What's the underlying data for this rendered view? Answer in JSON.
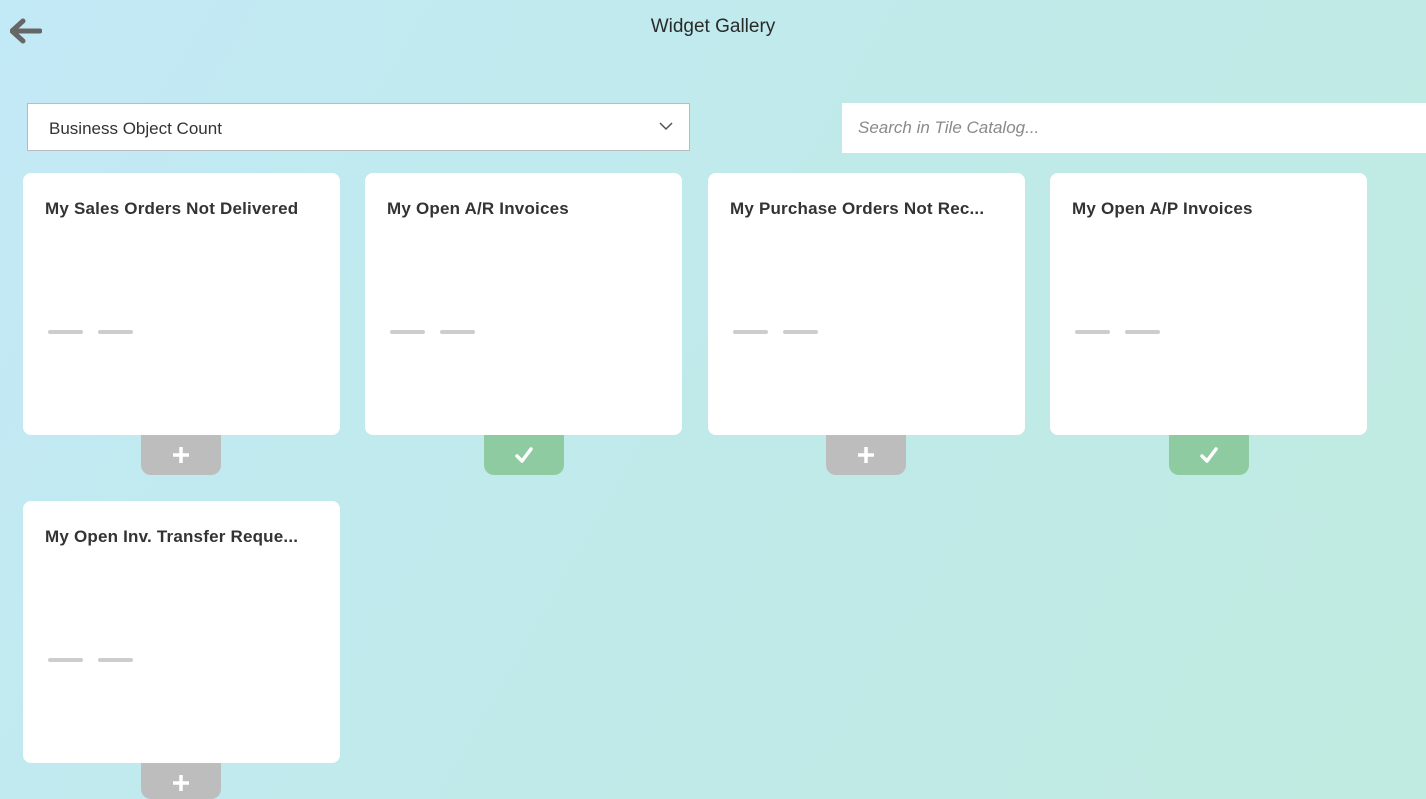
{
  "header": {
    "title": "Widget Gallery",
    "back_icon": "arrow-left-icon"
  },
  "filter": {
    "selected": "Business Object Count",
    "chevron_icon": "chevron-down-icon"
  },
  "search": {
    "placeholder": "Search in Tile Catalog...",
    "value": ""
  },
  "colors": {
    "added": "#8fcba0",
    "not_added": "#bdbdbd"
  },
  "tiles": [
    {
      "title": "My Sales Orders Not Delivered",
      "value": "— —",
      "added": false
    },
    {
      "title": "My Open A/R Invoices",
      "value": "— —",
      "added": true
    },
    {
      "title": "My Purchase Orders Not Rec...",
      "value": "— —",
      "added": false
    },
    {
      "title": "My Open A/P Invoices",
      "value": "— —",
      "added": true
    },
    {
      "title": "My Open Inv. Transfer Reque...",
      "value": "— —",
      "added": false
    }
  ]
}
